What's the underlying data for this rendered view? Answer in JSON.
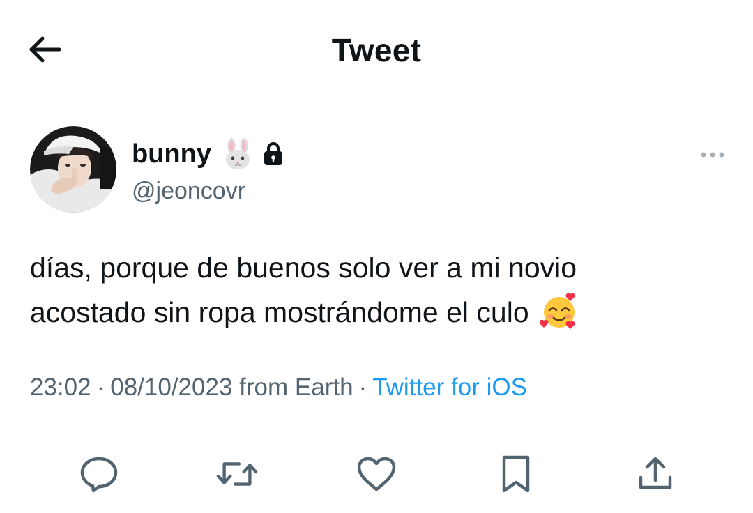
{
  "header": {
    "title": "Tweet",
    "back_icon": "arrow-left-icon"
  },
  "author": {
    "name": "bunny",
    "name_emoji": "rabbit-face-emoji",
    "protected_icon": "lock-icon",
    "handle": "@jeoncovr",
    "avatar_icon": "avatar-photo"
  },
  "tweet": {
    "line1": "días, porque de buenos solo ver a mi novio",
    "line2": "acostado sin ropa mostrándome el culo",
    "trailing_emoji": "smiling-face-with-hearts-emoji"
  },
  "meta": {
    "time": "23:02",
    "separator": "·",
    "date": "08/10/2023",
    "location": "from Earth",
    "source": "Twitter for iOS"
  },
  "actions": {
    "reply_icon": "reply-icon",
    "retweet_icon": "retweet-icon",
    "like_icon": "heart-icon",
    "bookmark_icon": "bookmark-icon",
    "share_icon": "share-icon"
  },
  "colors": {
    "text_primary": "#0f1419",
    "text_secondary": "#536471",
    "link": "#1d9bf0",
    "divider": "#eff3f4",
    "background": "#ffffff"
  }
}
